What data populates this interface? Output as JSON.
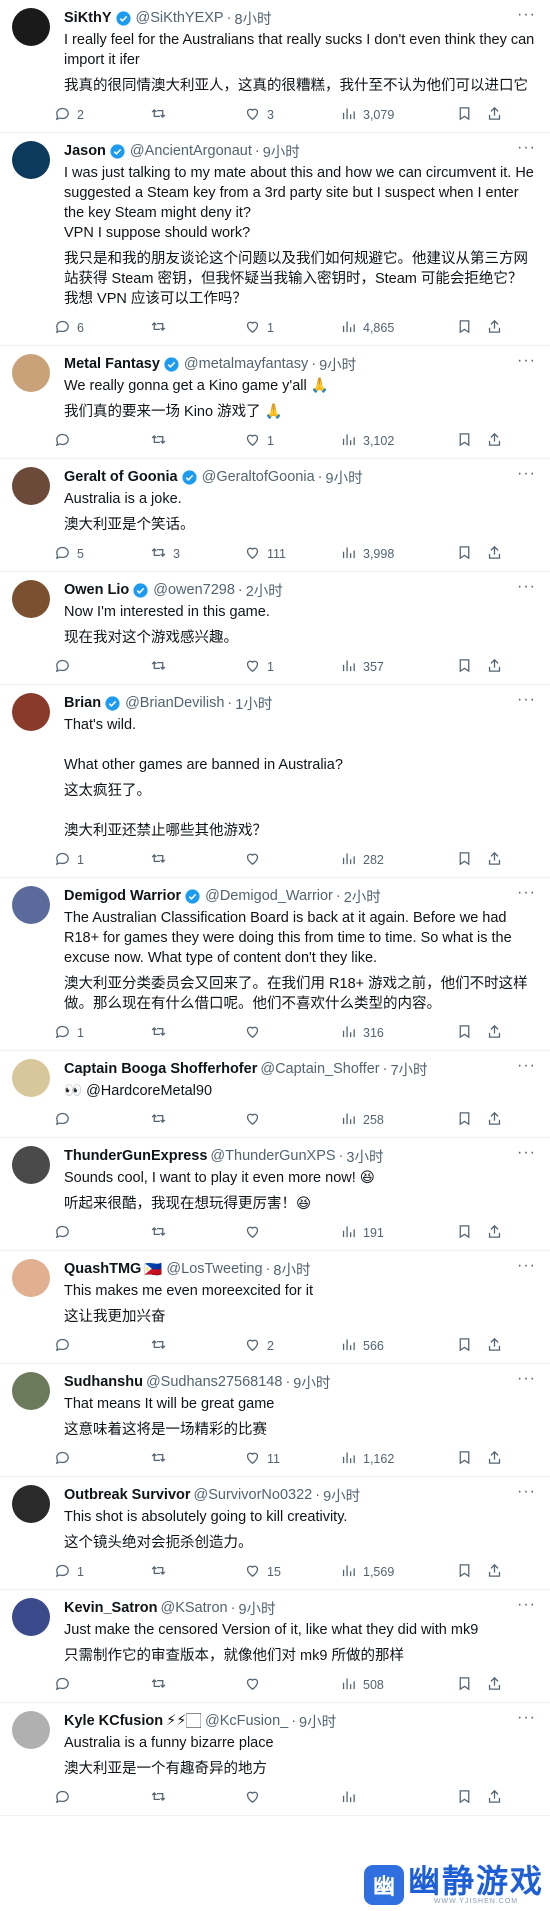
{
  "tweets": [
    {
      "name": "SiKthY",
      "verified": true,
      "handle": "@SiKthYEXP",
      "time": "8小时",
      "en": "I really feel for the Australians that really sucks I don't even think they can import it ifer",
      "cn": "我真的很同情澳大利亚人，这真的很糟糕，我什至不认为他们可以进口它",
      "replies": "2",
      "retweets": "",
      "likes": "3",
      "views": "3,079",
      "avatar_color": "#1a1a1a"
    },
    {
      "name": "Jason",
      "verified": true,
      "handle": "@AncientArgonaut",
      "time": "9小时",
      "en": "I was just talking to my mate about this and how we can circumvent it. He suggested a Steam key from a 3rd party site but I suspect when I enter the key Steam might deny it?\nVPN I suppose should work?",
      "cn": "我只是和我的朋友谈论这个问题以及我们如何规避它。他建议从第三方网站获得 Steam 密钥，但我怀疑当我输入密钥时，Steam 可能会拒绝它？\n我想 VPN 应该可以工作吗？",
      "replies": "6",
      "retweets": "",
      "likes": "1",
      "views": "4,865",
      "avatar_color": "#0b3a5c"
    },
    {
      "name": "Metal Fantasy",
      "verified": true,
      "handle": "@metalmayfantasy",
      "time": "9小时",
      "en": "We really gonna get a Kino game y'all 🙏",
      "cn": "我们真的要来一场 Kino 游戏了 🙏",
      "replies": "",
      "retweets": "",
      "likes": "1",
      "views": "3,102",
      "avatar_color": "#c9a27a"
    },
    {
      "name": "Geralt of Goonia",
      "verified": true,
      "handle": "@GeraltofGoonia",
      "time": "9小时",
      "en": "Australia is a joke.",
      "cn": "澳大利亚是个笑话。",
      "replies": "5",
      "retweets": "3",
      "likes": "111",
      "views": "3,998",
      "avatar_color": "#6b4a3a"
    },
    {
      "name": "Owen Lio",
      "verified": true,
      "handle": "@owen7298",
      "time": "2小时",
      "en": "Now I'm interested in this game.",
      "cn": "现在我对这个游戏感兴趣。",
      "replies": "",
      "retweets": "",
      "likes": "1",
      "views": "357",
      "avatar_color": "#7a5030"
    },
    {
      "name": "Brian",
      "verified": true,
      "handle": "@BrianDevilish",
      "time": "1小时",
      "en": "That's wild.\n\nWhat other games are banned in Australia?",
      "cn": "这太疯狂了。\n\n澳大利亚还禁止哪些其他游戏？",
      "replies": "1",
      "retweets": "",
      "likes": "",
      "views": "282",
      "avatar_color": "#8a3a2a"
    },
    {
      "name": "Demigod Warrior",
      "verified": true,
      "handle": "@Demigod_Warrior",
      "time": "2小时",
      "en": "The Australian Classification Board is back at it again. Before we had R18+ for games they were doing this from time to time. So what is the excuse now. What type of content don't they like.",
      "cn": "澳大利亚分类委员会又回来了。在我们用 R18+ 游戏之前，他们不时这样做。那么现在有什么借口呢。他们不喜欢什么类型的内容。",
      "replies": "1",
      "retweets": "",
      "likes": "",
      "views": "316",
      "avatar_color": "#5a6a9a"
    },
    {
      "name": "Captain Booga Shofferhofer",
      "verified": false,
      "handle": "@Captain_Shoffer",
      "time": "7小时",
      "en": "👀 @HardcoreMetal90",
      "cn": "",
      "replies": "",
      "retweets": "",
      "likes": "",
      "views": "258",
      "avatar_color": "#d8c79a"
    },
    {
      "name": "ThunderGunExpress",
      "verified": false,
      "handle": "@ThunderGunXPS",
      "time": "3小时",
      "en": "Sounds cool, I want to play it even more now! 😆",
      "cn": "听起来很酷，我现在想玩得更厉害！😆",
      "replies": "",
      "retweets": "",
      "likes": "",
      "views": "191",
      "avatar_color": "#4a4a4a"
    },
    {
      "name": "QuashTMG",
      "verified": false,
      "flag": "🇵🇭",
      "handle": "@LosTweeting",
      "time": "8小时",
      "en": "This makes me even moreexcited for it",
      "cn": "这让我更加兴奋",
      "replies": "",
      "retweets": "",
      "likes": "2",
      "views": "566",
      "avatar_color": "#e0b090"
    },
    {
      "name": "Sudhanshu",
      "verified": false,
      "handle": "@Sudhans27568148",
      "time": "9小时",
      "en": "That means It will be great game",
      "cn": "这意味着这将是一场精彩的比赛",
      "replies": "",
      "retweets": "",
      "likes": "11",
      "views": "1,162",
      "avatar_color": "#6a7a5a"
    },
    {
      "name": "Outbreak Survivor",
      "verified": false,
      "handle": "@SurvivorNo0322",
      "time": "9小时",
      "en": "This shot is absolutely going to kill creativity.",
      "cn": "这个镜头绝对会扼杀创造力。",
      "replies": "1",
      "retweets": "",
      "likes": "15",
      "views": "1,569",
      "avatar_color": "#2a2a2a"
    },
    {
      "name": "Kevin_Satron",
      "verified": false,
      "handle": "@KSatron",
      "time": "9小时",
      "en": "Just make the censored Version of it, like what they did with mk9",
      "cn": "只需制作它的审查版本，就像他们对 mk9 所做的那样",
      "replies": "",
      "retweets": "",
      "likes": "",
      "views": "508",
      "avatar_color": "#3a4a8a"
    },
    {
      "name": "Kyle KCfusion",
      "verified": false,
      "flag": "⚡⚡🏻",
      "handle": "@KcFusion_",
      "time": "9小时",
      "en": "Australia is a funny bizarre place",
      "cn": "澳大利亚是一个有趣奇异的地方",
      "replies": "",
      "retweets": "",
      "likes": "",
      "views": "",
      "avatar_color": "#b0b0b0"
    }
  ],
  "watermark": {
    "title": "幽静游戏",
    "subtitle": "WWW.YJISHEN.COM"
  },
  "colors": {
    "verified": "#1d9bf0",
    "muted": "#536471",
    "text": "#0f1419"
  }
}
